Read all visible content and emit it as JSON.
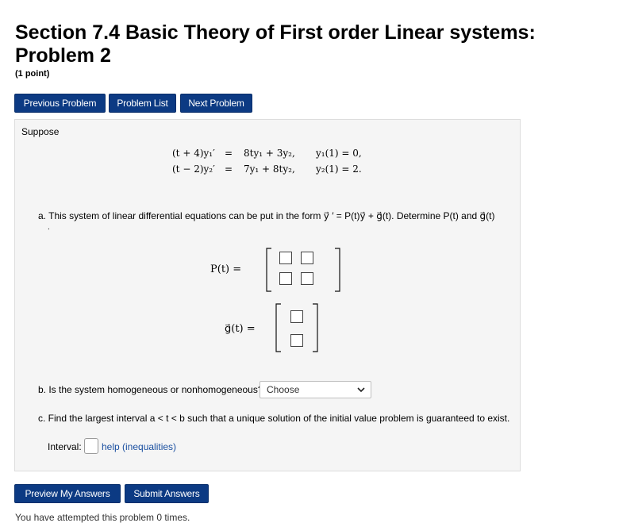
{
  "header": {
    "title_line1": "Section 7.4 Basic Theory of First order Linear systems:",
    "title_line2": "Problem 2",
    "points": "(1 point)"
  },
  "nav": {
    "previous": "Previous Problem",
    "list": "Problem List",
    "next": "Next Problem"
  },
  "problem": {
    "suppose": "Suppose",
    "eq1_lhs": "(t + 4)y₁′",
    "eq1_eq": "=",
    "eq1_rhs": "8ty₁ + 3y₂,",
    "eq1_ic": "y₁(1) = 0,",
    "eq2_lhs": "(t − 2)y₂′",
    "eq2_eq": "=",
    "eq2_rhs": "7y₁ + 8ty₂,",
    "eq2_ic": "y₂(1) = 2.",
    "part_a": "a. This system of linear differential equations can be put in the form y⃗ ′ = P(t)y⃗ + g⃗(t). Determine P(t) and g⃗(t)",
    "part_a_dot": ".",
    "P_label": "P(t) =",
    "g_label": "g⃗(t) =",
    "part_b": "b. Is the system homogeneous or nonhomogeneous?",
    "select_value": "Choose",
    "part_c": "c. Find the largest interval a < t < b such that a unique solution of the initial value problem is guaranteed to exist.",
    "interval_label": "Interval:",
    "help_link": "help (inequalities)"
  },
  "actions": {
    "preview": "Preview My Answers",
    "submit": "Submit Answers"
  },
  "footer": {
    "attempts": "You have attempted this problem 0 times."
  },
  "colors": {
    "button_bg": "#0c3a83",
    "panel_bg": "#f5f5f5",
    "link": "#1a4fa0"
  }
}
